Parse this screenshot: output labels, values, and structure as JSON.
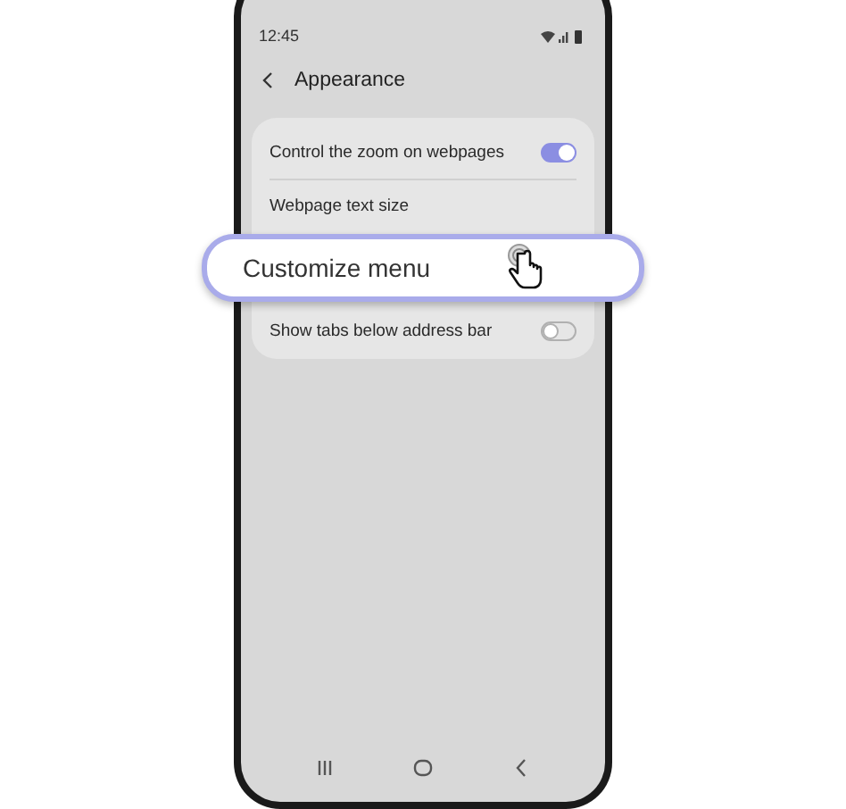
{
  "status_bar": {
    "time": "12:45"
  },
  "header": {
    "title": "Appearance"
  },
  "settings": [
    {
      "kind": "toggle",
      "label": "Control the zoom on webpages",
      "on": true
    },
    {
      "kind": "text",
      "label": "Webpage text size"
    },
    {
      "kind": "highlight",
      "label": "Customize menu"
    },
    {
      "kind": "toggle",
      "label": "Show tabs below address bar",
      "on": false
    }
  ]
}
